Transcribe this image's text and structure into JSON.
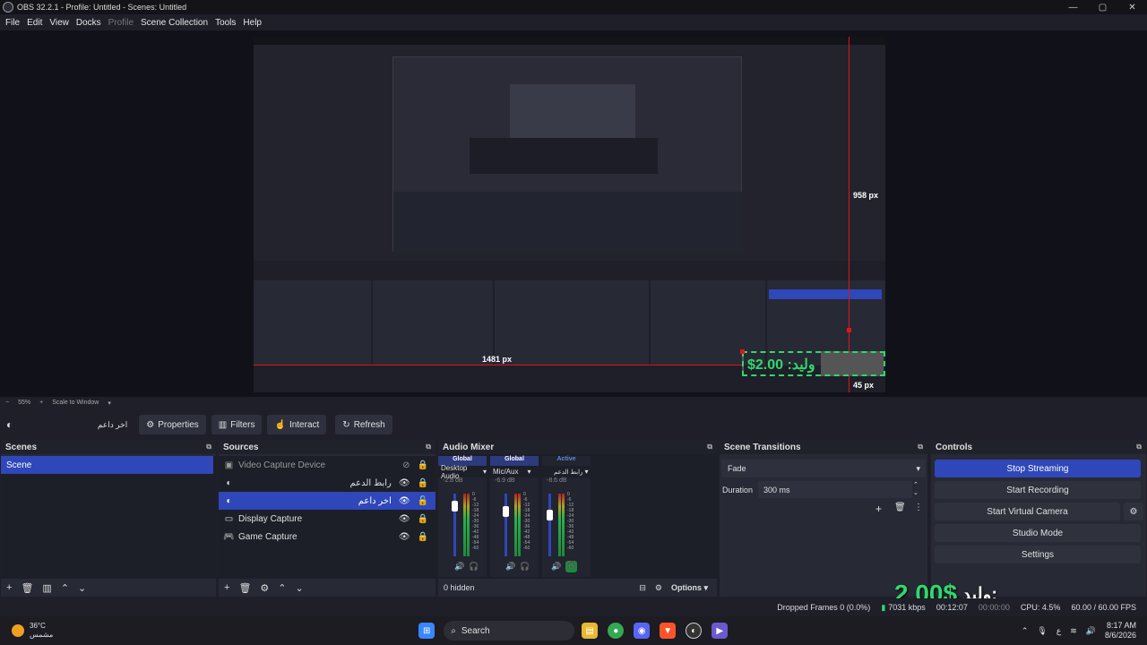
{
  "window": {
    "title": "OBS 32.2.1 - Profile: Untitled - Scenes: Untitled",
    "minimize": "—",
    "maximize": "▢",
    "close": "✕"
  },
  "menu": {
    "file": "File",
    "edit": "Edit",
    "view": "View",
    "docks": "Docks",
    "profile": "Profile",
    "scene_collection": "Scene Collection",
    "tools": "Tools",
    "help": "Help"
  },
  "preview": {
    "height_label": "958 px",
    "width_label": "1481 px",
    "bottom_label": "45 px",
    "overlay_text": "وليد: 2.00$"
  },
  "zoom": {
    "minus": "−",
    "value": "55%",
    "plus": "+",
    "mode": "Scale to Window"
  },
  "context": {
    "source_name": "اخر داعم",
    "properties": "Properties",
    "filters": "Filters",
    "interact": "Interact",
    "refresh": "Refresh"
  },
  "scenes": {
    "title": "Scenes",
    "items": [
      {
        "label": "Scene"
      }
    ]
  },
  "sources": {
    "title": "Sources",
    "items": [
      {
        "label": "Video Capture Device"
      },
      {
        "label": "رابط الدعم"
      },
      {
        "label": "اخر داعم"
      },
      {
        "label": "Display Capture"
      },
      {
        "label": "Game Capture"
      }
    ]
  },
  "mixer": {
    "title": "Audio Mixer",
    "channels": [
      {
        "tag": "Global",
        "name": "Desktop Audio",
        "db": "-2.8 dB",
        "level": 0.62
      },
      {
        "tag": "Global",
        "name": "Mic/Aux",
        "db": "-6.9 dB",
        "level": 0.55
      },
      {
        "tag": "Active",
        "name": "رابط الدعم",
        "db": "-8.6 dB",
        "level": 0.5
      }
    ],
    "hidden": "0 hidden",
    "options": "Options",
    "scale": [
      "0",
      "-6",
      "-12",
      "-18",
      "-24",
      "-30",
      "-36",
      "-42",
      "-48",
      "-54",
      "-60"
    ]
  },
  "transitions": {
    "title": "Scene Transitions",
    "selected": "Fade",
    "duration_label": "Duration",
    "duration_value": "300 ms"
  },
  "controls": {
    "title": "Controls",
    "stop_streaming": "Stop Streaming",
    "start_recording": "Start Recording",
    "start_virtual_camera": "Start Virtual Camera",
    "studio_mode": "Studio Mode",
    "settings": "Settings"
  },
  "overlay": {
    "donation_name": "وليد:",
    "donation_amount": "2.00$"
  },
  "status": {
    "dropped_frames": "Dropped Frames 0 (0.0%)",
    "bitrate": "7031 kbps",
    "stream_time": "00:12:07",
    "record_time": "00:00:00",
    "cpu": "CPU: 4.5%",
    "fps": "60.00 / 60.00 FPS"
  },
  "taskbar": {
    "temperature": "36°C",
    "weather": "مشمس",
    "search": "Search",
    "lang": "ع",
    "time": "8:17 AM",
    "date": "8/6/2026"
  },
  "colors": {
    "accent": "#2f47b9",
    "guide": "#e0141a",
    "overlay_green": "#31d86c"
  }
}
